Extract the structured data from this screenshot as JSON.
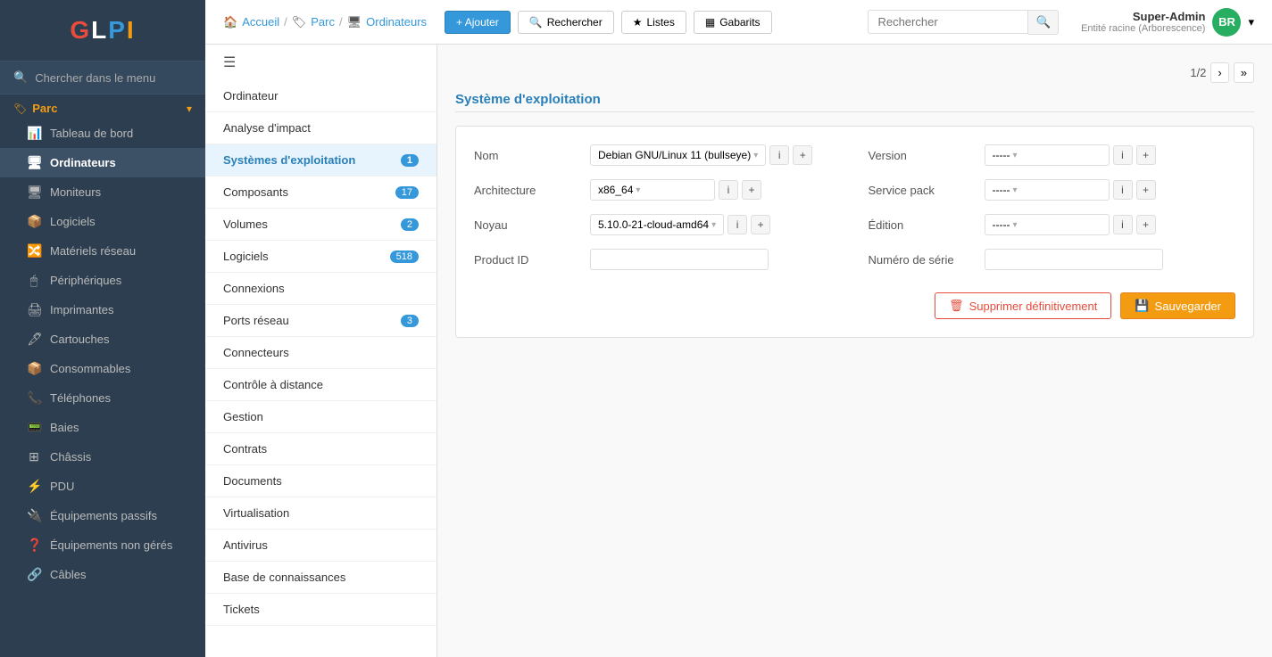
{
  "app": {
    "logo": "GLPI"
  },
  "sidebar": {
    "search_label": "Chercher dans le menu",
    "section_label": "Parc",
    "items": [
      {
        "id": "tableau-de-bord",
        "label": "Tableau de bord",
        "icon": "📊"
      },
      {
        "id": "ordinateurs",
        "label": "Ordinateurs",
        "icon": "🖥",
        "active": true
      },
      {
        "id": "moniteurs",
        "label": "Moniteurs",
        "icon": "🖥"
      },
      {
        "id": "logiciels",
        "label": "Logiciels",
        "icon": "📦"
      },
      {
        "id": "materiels-reseau",
        "label": "Matériels réseau",
        "icon": "🔀"
      },
      {
        "id": "peripheriques",
        "label": "Périphériques",
        "icon": "🖱"
      },
      {
        "id": "imprimantes",
        "label": "Imprimantes",
        "icon": "🖨"
      },
      {
        "id": "cartouches",
        "label": "Cartouches",
        "icon": "🖋"
      },
      {
        "id": "consommables",
        "label": "Consommables",
        "icon": "📦"
      },
      {
        "id": "telephones",
        "label": "Téléphones",
        "icon": "📞"
      },
      {
        "id": "baies",
        "label": "Baies",
        "icon": "📟"
      },
      {
        "id": "chassis",
        "label": "Châssis",
        "icon": "⊞"
      },
      {
        "id": "pdu",
        "label": "PDU",
        "icon": "⚡"
      },
      {
        "id": "equipements-passifs",
        "label": "Équipements passifs",
        "icon": "🔌"
      },
      {
        "id": "equipements-non-geres",
        "label": "Équipements non gérés",
        "icon": "❓"
      },
      {
        "id": "cables",
        "label": "Câbles",
        "icon": "🔗"
      }
    ]
  },
  "topbar": {
    "breadcrumb": [
      "Accueil",
      "Parc",
      "Ordinateurs"
    ],
    "buttons": {
      "add": "+ Ajouter",
      "search": "Rechercher",
      "lists": "Listes",
      "templates": "Gabarits"
    },
    "search_placeholder": "Rechercher",
    "user": {
      "name": "Super-Admin",
      "entity": "Entité racine (Arborescence)",
      "initials": "BR"
    }
  },
  "left_panel": {
    "items": [
      {
        "id": "ordinateur",
        "label": "Ordinateur",
        "badge": null
      },
      {
        "id": "analyse-impact",
        "label": "Analyse d'impact",
        "badge": null
      },
      {
        "id": "systemes-exploitation",
        "label": "Systèmes d'exploitation",
        "badge": "1",
        "active": true
      },
      {
        "id": "composants",
        "label": "Composants",
        "badge": "17"
      },
      {
        "id": "volumes",
        "label": "Volumes",
        "badge": "2"
      },
      {
        "id": "logiciels",
        "label": "Logiciels",
        "badge": "518"
      },
      {
        "id": "connexions",
        "label": "Connexions",
        "badge": null
      },
      {
        "id": "ports-reseau",
        "label": "Ports réseau",
        "badge": "3"
      },
      {
        "id": "connecteurs",
        "label": "Connecteurs",
        "badge": null
      },
      {
        "id": "controle-distance",
        "label": "Contrôle à distance",
        "badge": null
      },
      {
        "id": "gestion",
        "label": "Gestion",
        "badge": null
      },
      {
        "id": "contrats",
        "label": "Contrats",
        "badge": null
      },
      {
        "id": "documents",
        "label": "Documents",
        "badge": null
      },
      {
        "id": "virtualisation",
        "label": "Virtualisation",
        "badge": null
      },
      {
        "id": "antivirus",
        "label": "Antivirus",
        "badge": null
      },
      {
        "id": "base-connaissances",
        "label": "Base de connaissances",
        "badge": null
      },
      {
        "id": "tickets",
        "label": "Tickets",
        "badge": null
      }
    ]
  },
  "main": {
    "pagination": "1/2",
    "section_title": "Système d'exploitation",
    "fields": {
      "left": {
        "nom": {
          "label": "Nom",
          "value": "Debian GNU/Linux 11 (bullseye)"
        },
        "architecture": {
          "label": "Architecture",
          "value": "x86_64"
        },
        "noyau": {
          "label": "Noyau",
          "value": "5.10.0-21-cloud-amd64"
        },
        "product_id": {
          "label": "Product ID",
          "value": ""
        }
      },
      "right": {
        "version": {
          "label": "Version",
          "value": "-----"
        },
        "service_pack": {
          "label": "Service pack",
          "value": "-----"
        },
        "edition": {
          "label": "Édition",
          "value": "-----"
        },
        "numero_serie": {
          "label": "Numéro de série",
          "value": ""
        }
      }
    },
    "buttons": {
      "delete": "Supprimer définitivement",
      "save": "Sauvegarder"
    }
  }
}
